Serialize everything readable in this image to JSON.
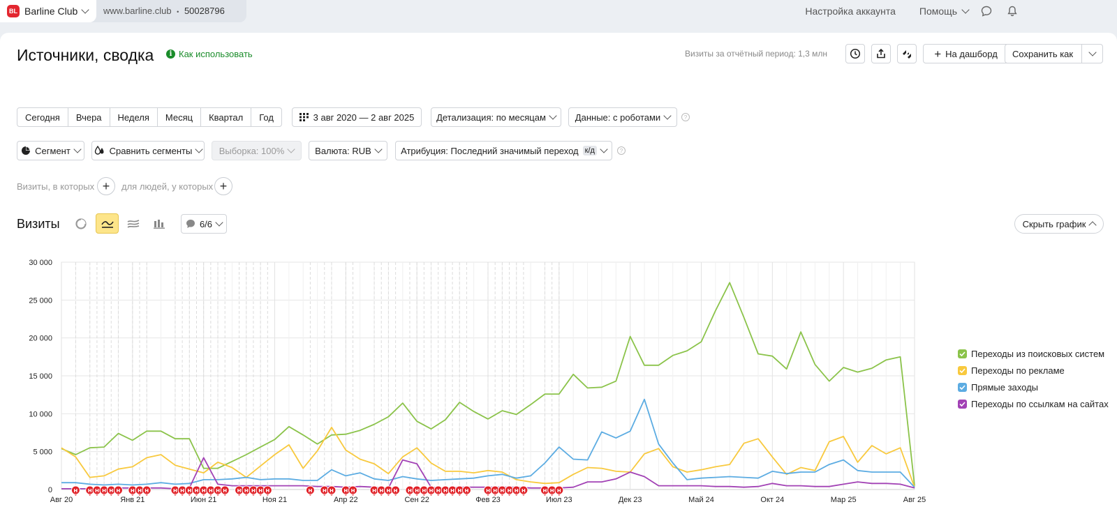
{
  "topbar": {
    "site_name": "Barline Club",
    "site_logo_text": "BL",
    "url": "www.barline.club",
    "separator": "•",
    "counter_id": "50028796",
    "account_settings": "Настройка аккаунта",
    "help": "Помощь"
  },
  "header": {
    "title": "Источники, сводка",
    "howto": "Как использовать",
    "visits_period": "Визиты за отчётный период: 1,3 млн",
    "to_dashboard": "На дашборд",
    "save_as": "Сохранить как"
  },
  "periods": [
    "Сегодня",
    "Вчера",
    "Неделя",
    "Месяц",
    "Квартал",
    "Год"
  ],
  "filters": {
    "date_range": "3 авг 2020 — 2 авг 2025",
    "detail": "Детализация: по месяцам",
    "data": "Данные: с роботами",
    "segment": "Сегмент",
    "compare": "Сравнить сегменты",
    "sample": "Выборка: 100%",
    "currency": "Валюта: RUB",
    "attribution": "Атрибуция: Последний значимый переход",
    "attribution_badge": "к/д",
    "visits_where": "Визиты, в которых",
    "people_where": "для людей, у которых"
  },
  "chart_section": {
    "title": "Визиты",
    "series_count": "6/6",
    "hide_chart": "Скрыть график"
  },
  "chart_data": {
    "type": "line",
    "ylim": [
      0,
      30000
    ],
    "y_ticks": [
      "30 000",
      "25 000",
      "20 000",
      "15 000",
      "10 000",
      "5 000",
      "0"
    ],
    "x_tick_labels": [
      "Авг 20",
      "Янв 21",
      "Июн 21",
      "Ноя 21",
      "Апр 22",
      "Сен 22",
      "Фев 23",
      "Июл 23",
      "Дек 23",
      "Май 24",
      "Окт 24",
      "Мар 25",
      "Авг 25"
    ],
    "x": [
      "Авг 20",
      "Сен 20",
      "Окт 20",
      "Ноя 20",
      "Дек 20",
      "Янв 21",
      "Фев 21",
      "Мар 21",
      "Апр 21",
      "Май 21",
      "Июн 21",
      "Июл 21",
      "Авг 21",
      "Сен 21",
      "Окт 21",
      "Ноя 21",
      "Дек 21",
      "Янв 22",
      "Фев 22",
      "Мар 22",
      "Апр 22",
      "Май 22",
      "Июн 22",
      "Июл 22",
      "Авг 22",
      "Сен 22",
      "Окт 22",
      "Ноя 22",
      "Дек 22",
      "Янв 23",
      "Фев 23",
      "Мар 23",
      "Апр 23",
      "Май 23",
      "Июн 23",
      "Июл 23",
      "Авг 23",
      "Сен 23",
      "Окт 23",
      "Ноя 23",
      "Дек 23",
      "Янв 24",
      "Фев 24",
      "Мар 24",
      "Апр 24",
      "Май 24",
      "Июн 24",
      "Июл 24",
      "Авг 24",
      "Сен 24",
      "Окт 24",
      "Ноя 24",
      "Дек 24",
      "Янв 25",
      "Фев 25",
      "Мар 25",
      "Апр 25",
      "Май 25",
      "Июн 25",
      "Июл 25",
      "Авг 25"
    ],
    "series": [
      {
        "name": "Переходы из поисковых систем",
        "color": "#8bc34a",
        "values": [
          5400,
          4600,
          5500,
          5600,
          7400,
          6500,
          7700,
          7700,
          6700,
          6700,
          2800,
          2800,
          3700,
          4600,
          5600,
          6600,
          8300,
          7200,
          6000,
          7200,
          7300,
          7800,
          8600,
          9600,
          11400,
          9000,
          8000,
          9200,
          11500,
          10300,
          9300,
          10400,
          9900,
          11200,
          12600,
          12600,
          15200,
          13400,
          13500,
          14300,
          20200,
          16400,
          16400,
          17700,
          18300,
          19500,
          23600,
          27300,
          22700,
          17900,
          17600,
          15900,
          20800,
          16500,
          14300,
          16100,
          15500,
          16000,
          17100,
          17500,
          500
        ]
      },
      {
        "name": "Переходы по рекламе",
        "color": "#f8c93e",
        "values": [
          5500,
          4300,
          1600,
          1800,
          2700,
          3000,
          4200,
          4600,
          3200,
          2700,
          2200,
          3600,
          2900,
          1600,
          3100,
          4600,
          5900,
          2800,
          5100,
          8200,
          5200,
          4000,
          3400,
          2100,
          4300,
          5500,
          3500,
          2400,
          2400,
          2200,
          2500,
          2300,
          1300,
          1000,
          800,
          900,
          2000,
          2900,
          2800,
          2400,
          2300,
          4700,
          5400,
          3000,
          2300,
          2600,
          3000,
          3300,
          6100,
          6700,
          4300,
          2000,
          2900,
          2500,
          6300,
          7000,
          3600,
          5800,
          4700,
          5500,
          300
        ]
      },
      {
        "name": "Прямые заходы",
        "color": "#5cace2",
        "values": [
          900,
          900,
          700,
          600,
          700,
          600,
          700,
          900,
          700,
          800,
          1300,
          1300,
          1400,
          1600,
          1300,
          1400,
          1400,
          1200,
          1200,
          2600,
          1800,
          2200,
          1400,
          1200,
          1700,
          1400,
          1200,
          1300,
          1400,
          1500,
          1800,
          2000,
          1500,
          1800,
          3500,
          5600,
          4000,
          3900,
          7600,
          6800,
          7700,
          11900,
          6000,
          3500,
          1300,
          1500,
          1600,
          1700,
          1600,
          1500,
          2400,
          2100,
          2300,
          2300,
          3300,
          3900,
          2500,
          2300,
          2300,
          2300,
          300
        ]
      },
      {
        "name": "Переходы по ссылкам на сайтах",
        "color": "#a242b5",
        "values": [
          100,
          100,
          100,
          100,
          200,
          200,
          200,
          200,
          100,
          200,
          4200,
          700,
          500,
          500,
          500,
          500,
          500,
          500,
          400,
          400,
          300,
          400,
          300,
          200,
          3900,
          3400,
          300,
          200,
          300,
          300,
          300,
          300,
          300,
          200,
          200,
          200,
          300,
          1000,
          1000,
          1400,
          2300,
          1700,
          500,
          500,
          500,
          500,
          400,
          400,
          300,
          400,
          800,
          500,
          500,
          400,
          400,
          700,
          1000,
          800,
          800,
          700,
          200
        ]
      }
    ]
  },
  "legend": [
    {
      "label": "Переходы из поисковых систем",
      "color": "#8bc34a"
    },
    {
      "label": "Переходы по рекламе",
      "color": "#f8c93e"
    },
    {
      "label": "Прямые заходы",
      "color": "#5cace2"
    },
    {
      "label": "Переходы по ссылкам на сайтах",
      "color": "#a242b5"
    }
  ],
  "annotation_marker": "Н",
  "annotation_months": [
    2,
    4,
    5,
    6,
    7,
    8,
    10,
    11,
    12,
    16,
    17,
    18,
    19,
    20,
    21,
    22,
    23,
    25,
    26,
    27,
    28,
    29,
    35,
    37,
    38,
    40,
    41,
    44,
    45,
    46,
    47,
    49,
    50,
    51,
    52,
    53,
    54,
    55,
    56,
    57,
    60,
    61,
    62,
    63,
    64,
    65,
    68,
    69,
    70
  ]
}
